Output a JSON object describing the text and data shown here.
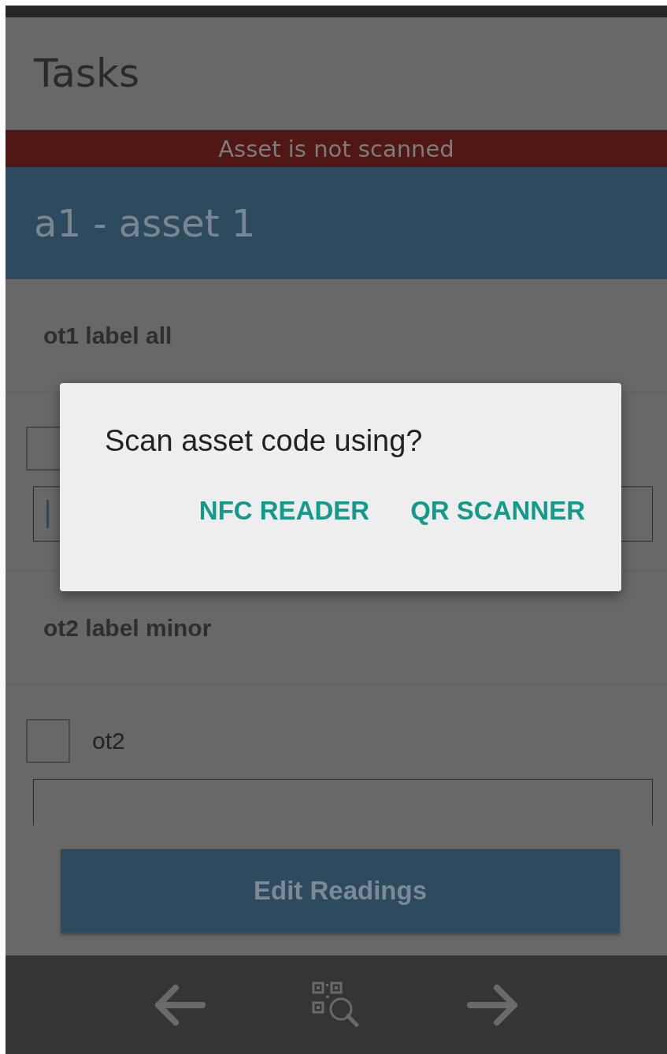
{
  "header": {
    "title": "Tasks"
  },
  "banner": {
    "text": "Asset is not scanned"
  },
  "asset": {
    "title": "a1 - asset 1"
  },
  "sections": [
    {
      "label": "ot1 label all",
      "items": [
        {
          "checked": false,
          "focused": true
        }
      ]
    },
    {
      "label": "ot2 label minor",
      "items": [
        {
          "label": "ot2",
          "checked": false,
          "focused": false
        }
      ]
    }
  ],
  "button": {
    "label": "Edit Readings"
  },
  "dialog": {
    "title": "Scan asset code using?",
    "actions": [
      "NFC READER",
      "QR SCANNER"
    ]
  }
}
